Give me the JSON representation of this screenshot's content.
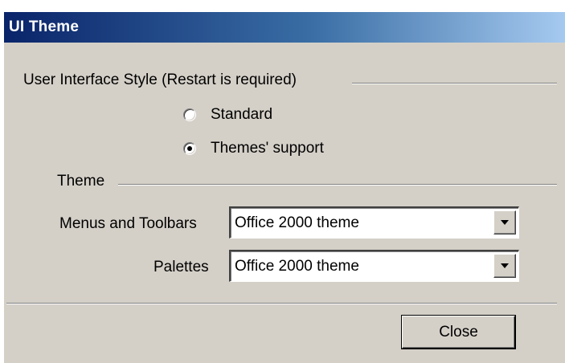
{
  "window": {
    "title": "UI Theme"
  },
  "style_group": {
    "label": "User Interface Style  (Restart is required)",
    "options": [
      {
        "label": "Standard",
        "selected": false
      },
      {
        "label": "Themes' support",
        "selected": true
      }
    ]
  },
  "theme_group": {
    "label": "Theme",
    "menus_toolbars": {
      "label": "Menus and Toolbars",
      "value": "Office 2000 theme"
    },
    "palettes": {
      "label": "Palettes",
      "value": "Office 2000 theme"
    }
  },
  "footer": {
    "close_label": "Close"
  },
  "colors": {
    "face": "#d4d0c8",
    "title_start": "#0a246a",
    "title_end": "#a6caf0"
  }
}
